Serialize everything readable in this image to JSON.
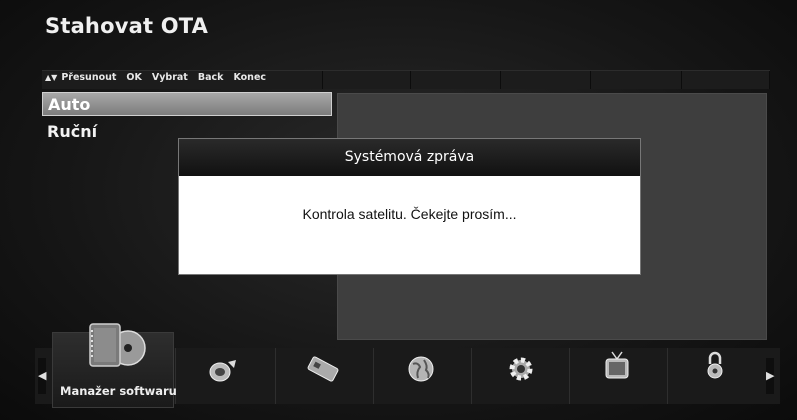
{
  "screen_title": "Stahovat OTA",
  "hints": {
    "move_symbol": "▲▼",
    "move": "Přesunout",
    "ok_key": "OK",
    "select": "Vybrat",
    "back_key": "Back",
    "exit": "Konec"
  },
  "menu": {
    "items": [
      {
        "label": "Auto",
        "selected": true
      },
      {
        "label": "Ruční",
        "selected": false
      }
    ]
  },
  "dialog": {
    "title": "Systémová zpráva",
    "message": "Kontrola satelitu. Čekejte prosím..."
  },
  "dock": {
    "active_label": "Manažer softwaru",
    "icons": [
      "software-manager-icon",
      "satellite-dish-icon",
      "card-icon",
      "globe-icon",
      "settings-gear-icon",
      "tv-icon",
      "padlock-icon"
    ],
    "left_arrow": "◀",
    "right_arrow": "▶"
  }
}
